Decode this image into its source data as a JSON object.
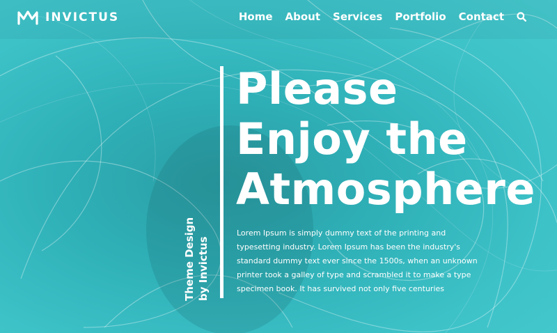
{
  "brand": {
    "name": "INVICTUS",
    "icon": "crown-logo-icon"
  },
  "nav": {
    "items": [
      {
        "label": "Home"
      },
      {
        "label": "About"
      },
      {
        "label": "Services"
      },
      {
        "label": "Portfolio"
      },
      {
        "label": "Contact"
      }
    ],
    "search_icon": "search-icon"
  },
  "hero": {
    "headline_lines": [
      "Please",
      "Enjoy the",
      "Atmosphere"
    ],
    "side_text_lines": [
      "Theme Design",
      "by Invictus"
    ],
    "description": "Lorem Ipsum is simply dummy text of the printing and typesetting industry. Lorem Ipsum has been the industry's standard dummy text ever since the 1500s, when an unknown printer took a galley of type and scrambled it to make a type specimen book. It has survived not only five centuries"
  },
  "colors": {
    "background": "#3dbfc5",
    "text": "#ffffff"
  }
}
